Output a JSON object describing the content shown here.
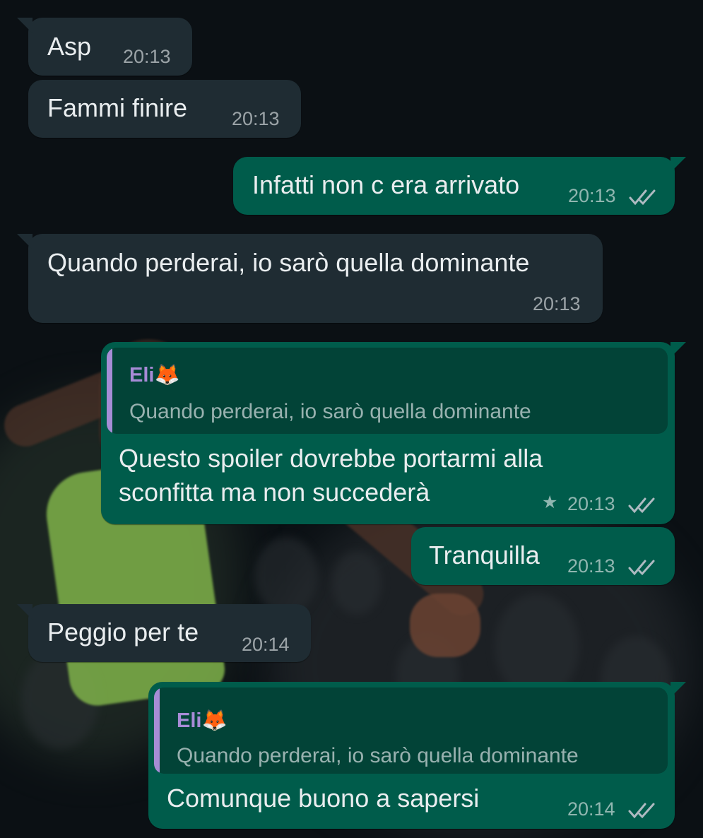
{
  "messages": [
    {
      "direction": "incoming",
      "text": "Asp",
      "time": "20:13"
    },
    {
      "direction": "incoming",
      "text": "Fammi finire",
      "time": "20:13"
    },
    {
      "direction": "outgoing",
      "text": "Infatti non c era arrivato",
      "time": "20:13",
      "status": "read"
    },
    {
      "direction": "incoming",
      "text": "Quando perderai, io sarò quella dominante",
      "time": "20:13"
    },
    {
      "direction": "outgoing",
      "quote": {
        "author": "Eli🦊",
        "text": "Quando perderai, io sarò quella dominante"
      },
      "text_line1": "Questo spoiler dovrebbe portarmi alla",
      "text_line2": "sconfitta ma non succederà",
      "time": "20:13",
      "starred": true,
      "status": "read"
    },
    {
      "direction": "outgoing",
      "text": "Tranquilla",
      "time": "20:13",
      "status": "read"
    },
    {
      "direction": "incoming",
      "text": "Peggio per te",
      "time": "20:14"
    },
    {
      "direction": "outgoing",
      "quote": {
        "author": "Eli🦊",
        "text": "Quando perderai, io sarò quella dominante"
      },
      "text": "Comunque buono a sapersi",
      "time": "20:14",
      "status": "read"
    }
  ],
  "icons": {
    "read_receipt": "double-check-icon",
    "star": "star-icon"
  },
  "colors": {
    "incoming_bubble": "#1f2c33",
    "outgoing_bubble": "#005c4b",
    "quote_bar": "#a68dd6",
    "quote_author": "#a78bd6",
    "background": "#0b1014"
  }
}
